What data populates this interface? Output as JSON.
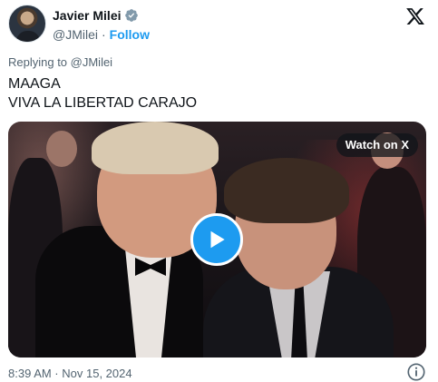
{
  "author": {
    "name": "Javier Milei",
    "handle": "@JMilei",
    "separator": "·",
    "follow_label": "Follow",
    "verified_icon": "verified-badge-icon"
  },
  "reply_to": "Replying to @JMilei",
  "tweet": {
    "line1": "MAAGA",
    "line2": "VIVA LA LIBERTAD CARAJO"
  },
  "media": {
    "type": "video",
    "watch_label": "Watch on X",
    "play_icon": "play-icon"
  },
  "timestamp": "8:39 AM · Nov 15, 2024",
  "colors": {
    "accent": "#1d9bf0",
    "text": "#0f1419",
    "muted": "#536471"
  },
  "icons": {
    "logo": "x-logo-icon",
    "info": "info-icon"
  }
}
